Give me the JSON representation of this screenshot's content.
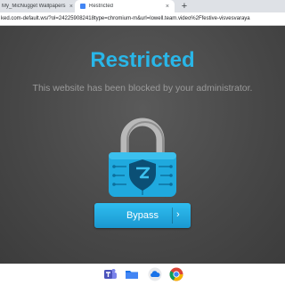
{
  "tabs": [
    {
      "label": "My_MicNugget Wallpapers - Wo",
      "close": "×"
    },
    {
      "label": "Restricted",
      "close": "×"
    }
  ],
  "new_tab_label": "+",
  "address_bar": {
    "url": "ked.com-default.ws/?ol=242259082418type=chromium-m&url=lowell.team.video%2Ffestive-visvesvaraya"
  },
  "page": {
    "title": "Restricted",
    "subtitle": "This website has been blocked by your administrator.",
    "bypass_label": "Bypass",
    "bypass_chevron": "›"
  },
  "shelf": {
    "icons": [
      "teams-icon",
      "files-icon",
      "cloud-icon",
      "chrome-icon"
    ]
  },
  "colors": {
    "accent": "#29b6e8",
    "page_background": "#4a4a4a",
    "subtitle": "#9a9a9a"
  }
}
